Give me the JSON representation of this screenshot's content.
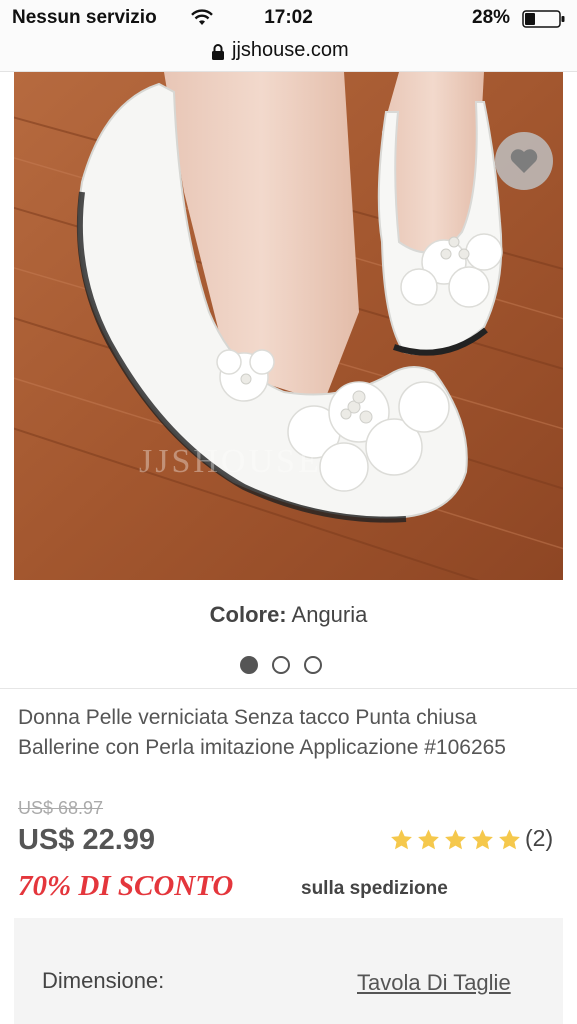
{
  "status_bar": {
    "carrier": "Nessun servizio",
    "time": "17:02",
    "battery": "28%"
  },
  "url_bar": {
    "url": "jjshouse.com"
  },
  "product": {
    "color_label": "Colore:",
    "color_value": "Anguria",
    "image_count": 3,
    "active_image": 1,
    "title": "Donna Pelle verniciata Senza tacco Punta chiusa Ballerine con Perla imitazione Applicazione #106265",
    "old_price": "US$ 68.97",
    "price": "US$ 22.99",
    "rating_stars": 5,
    "review_count": "(2)",
    "discount": "70% DI SCONTO",
    "shipping_note": "sulla spedizione",
    "watermark": "JJSHOUSE"
  },
  "size_panel": {
    "label": "Dimensione:",
    "size_chart_link": "Tavola Di Taglie"
  },
  "colors": {
    "discount_red": "#e4363c",
    "star_gold": "#f5c84c",
    "text_gray": "#555555"
  },
  "icons": [
    "wifi-icon",
    "battery-icon",
    "lock-icon",
    "heart-icon",
    "star-icon"
  ]
}
